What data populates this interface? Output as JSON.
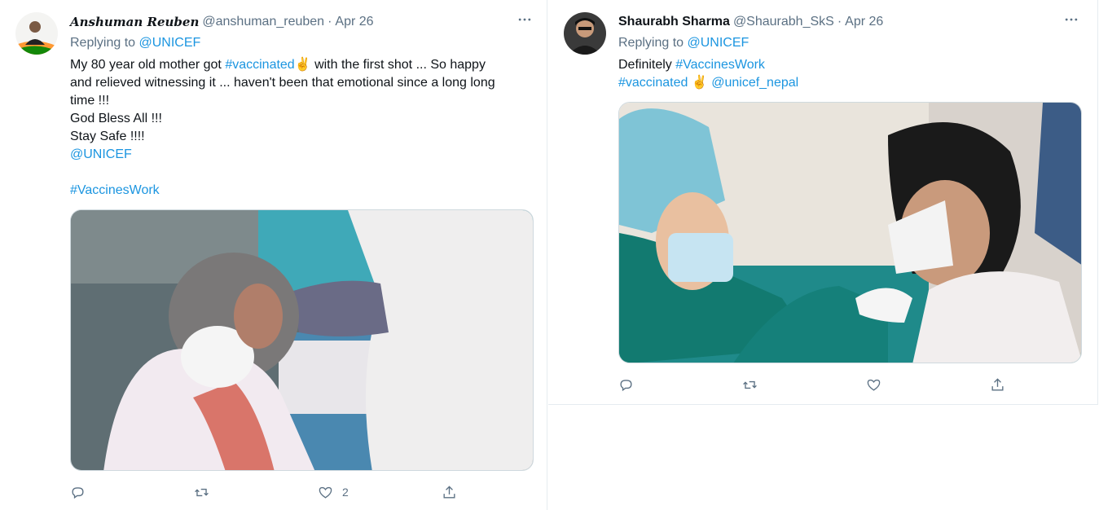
{
  "tweets": [
    {
      "display_name": "Anshuman Reuben",
      "handle": "@anshuman_reuben",
      "separator": "·",
      "date": "Apr 26",
      "replying_prefix": "Replying to",
      "replying_to": "@UNICEF",
      "text": {
        "l1_a": "My 80 year old mother got ",
        "l1_tag": "#vaccinated",
        "l1_emoji": "✌",
        "l1_b": " with the first shot ... So happy",
        "l2": "and relieved witnessing it ... haven't been that emotional since a long long",
        "l3": "time !!!",
        "l4": "God Bless All !!!",
        "l5": "Stay Safe !!!!",
        "l6": "@UNICEF",
        "l8": "#VaccinesWork"
      },
      "actions": {
        "reply_count": "",
        "retweet_count": "",
        "like_count": "2"
      },
      "icons": [
        "reply-icon",
        "retweet-icon",
        "like-icon",
        "share-icon",
        "more-icon"
      ]
    },
    {
      "display_name": "Shaurabh Sharma",
      "handle": "@Shaurabh_SkS",
      "separator": "·",
      "date": "Apr 26",
      "replying_prefix": "Replying to",
      "replying_to": "@UNICEF",
      "text": {
        "l1_a": "Definitely ",
        "l1_tag": "#VaccinesWork",
        "l2_tag": "#vaccinated",
        "l2_emoji": "✌",
        "l2_mention": "@unicef_nepal"
      },
      "actions": {
        "reply_count": "",
        "retweet_count": "",
        "like_count": ""
      },
      "icons": [
        "reply-icon",
        "retweet-icon",
        "like-icon",
        "share-icon",
        "more-icon"
      ]
    }
  ],
  "colors": {
    "link": "#1b95e0",
    "muted": "#5b7083",
    "text": "#0f1419",
    "border": "#e6ecf0"
  }
}
